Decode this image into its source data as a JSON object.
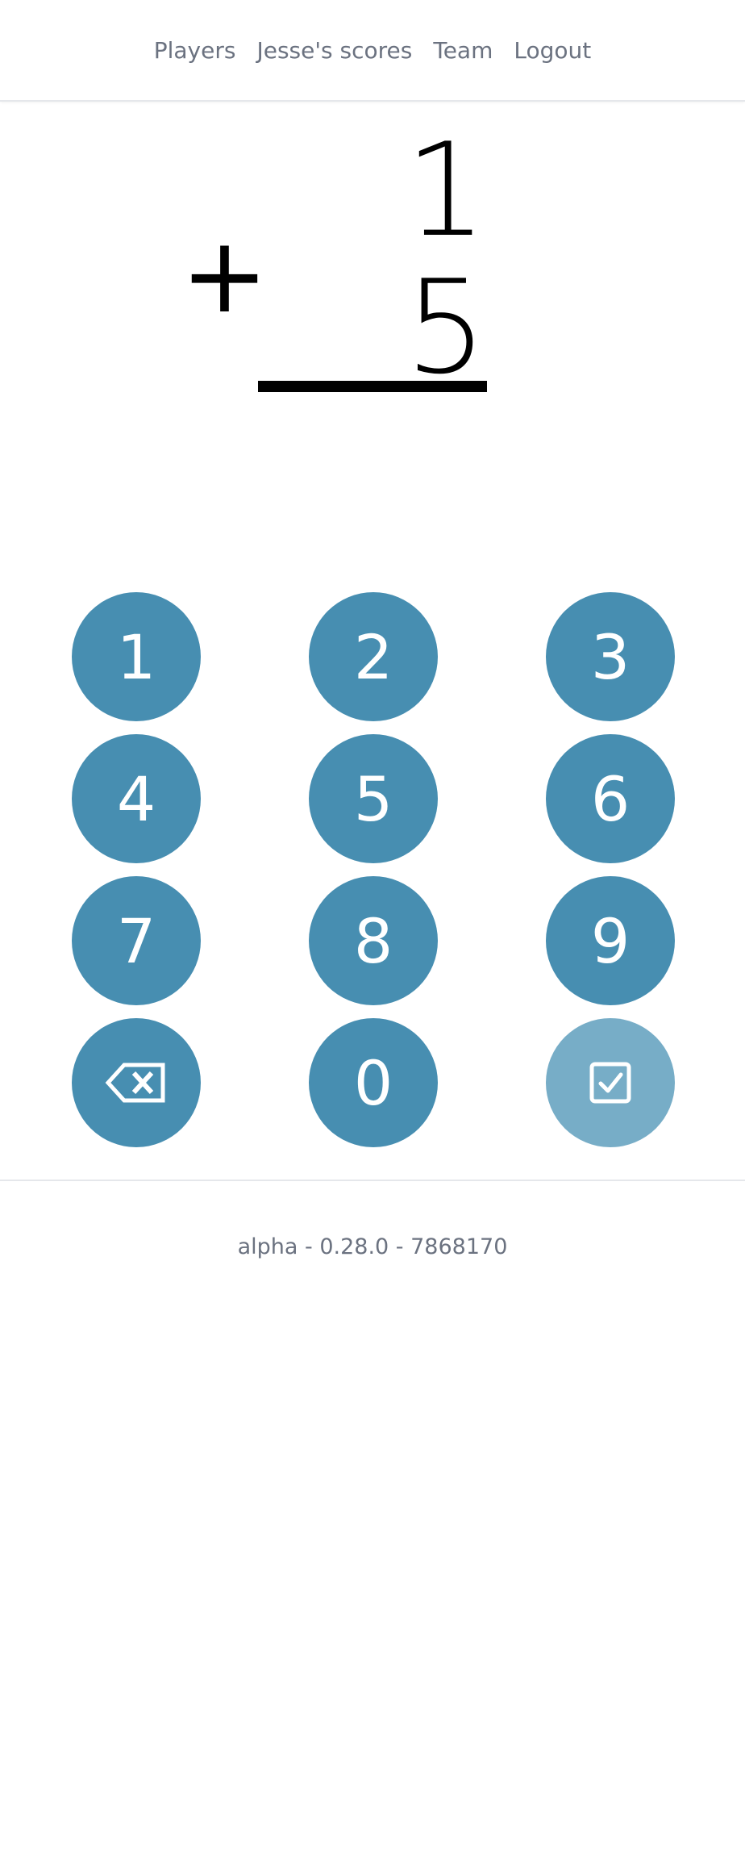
{
  "nav": {
    "players": "Players",
    "scores": "Jesse's scores",
    "team": "Team",
    "logout": "Logout"
  },
  "problem": {
    "top": "1",
    "operator": "+",
    "bottom": "5",
    "answer": ""
  },
  "keypad": {
    "k1": "1",
    "k2": "2",
    "k3": "3",
    "k4": "4",
    "k5": "5",
    "k6": "6",
    "k7": "7",
    "k8": "8",
    "k9": "9",
    "k0": "0",
    "backspace_icon": "backspace-icon",
    "submit_icon": "checkbox-icon",
    "submit_enabled": false
  },
  "colors": {
    "key_bg": "#478eb1",
    "key_disabled_bg": "#77adc7",
    "nav_text": "#6b7280"
  },
  "footer": {
    "version": "alpha - 0.28.0 - 7868170"
  }
}
